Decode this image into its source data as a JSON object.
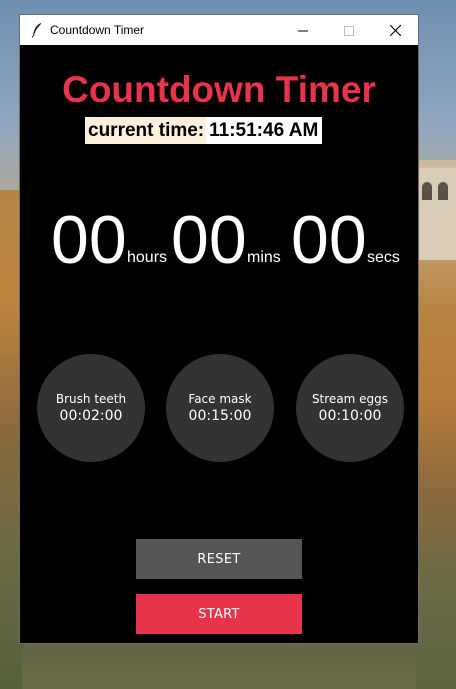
{
  "window": {
    "title": "Countdown Timer",
    "controls": [
      "minimize",
      "maximize",
      "close"
    ]
  },
  "app": {
    "heading": "Countdown Timer",
    "heading_color": "#e8344a",
    "current_time_label": "current time:",
    "current_time_value": "11:51:46 AM"
  },
  "countdown": {
    "hours": "00",
    "hours_unit": "hours",
    "mins": "00",
    "mins_unit": "mins",
    "secs": "00",
    "secs_unit": "secs"
  },
  "presets": [
    {
      "name": "Brush teeth",
      "time": "00:02:00"
    },
    {
      "name": "Face mask",
      "time": "00:15:00"
    },
    {
      "name": "Stream eggs",
      "time": "00:10:00"
    }
  ],
  "buttons": {
    "reset": "RESET",
    "start": "START"
  },
  "colors": {
    "accent": "#e8344a",
    "window_bg": "#000000",
    "preset_bg": "#333333",
    "reset_bg": "#555555"
  },
  "icons": {
    "app": "feather-icon",
    "minimize": "minimize-icon",
    "maximize": "maximize-icon",
    "close": "close-icon"
  }
}
